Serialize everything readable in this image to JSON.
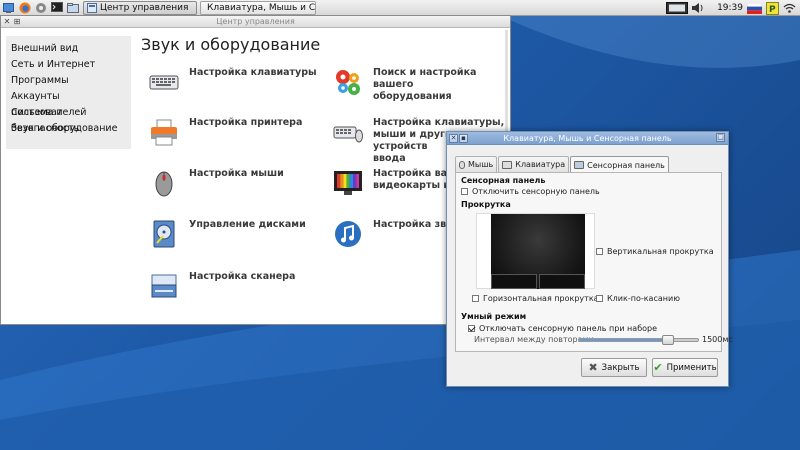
{
  "taskbar": {
    "launchers": [
      "desktop-icon",
      "firefox-icon",
      "settings-icon",
      "terminal-icon",
      "file-manager-icon"
    ],
    "tasks": [
      {
        "label": "Центр управления",
        "icon": "control-center-icon"
      },
      {
        "label": "Клавиатура, Мышь и Сенс...",
        "icon": "keyboard-mouse-icon"
      }
    ],
    "clock": "19:39",
    "tray": [
      "display-icon",
      "sound-icon",
      "language-flag-icon",
      "updates-icon",
      "wifi-icon"
    ]
  },
  "main_window": {
    "title": "Центр управления",
    "sidebar": [
      "Внешний вид",
      "Сеть и Интернет",
      "Программы",
      "Аккаунты пользователей",
      "Система и безопасность",
      "Звук и оборудование"
    ],
    "page_title": "Звук и оборудование",
    "items": [
      {
        "label": "Настройка клавиатуры",
        "icon": "keyboard-icon"
      },
      {
        "label": "Поиск и настройка вашего\nоборудования",
        "icon": "hardware-gears-icon"
      },
      {
        "label": "Настройка принтера",
        "icon": "printer-icon"
      },
      {
        "label": "Настройка клавиатуры,\nмыши и других устройств\nввода",
        "icon": "input-devices-icon"
      },
      {
        "label": "Настройка мыши",
        "icon": "mouse-icon"
      },
      {
        "label": "Настройка вашей\nвидеокарты и мон",
        "icon": "monitor-icon"
      },
      {
        "label": "Управление дисками",
        "icon": "disk-icon"
      },
      {
        "label": "Настройка звука",
        "icon": "music-note-icon"
      },
      {
        "label": "Настройка сканера",
        "icon": "scanner-icon"
      }
    ]
  },
  "dialog": {
    "title": "Клавиатура, Мышь и Сенсорная панель",
    "tabs": [
      "Мышь",
      "Клавиатура",
      "Сенсорная панель"
    ],
    "active_tab": "Сенсорная панель",
    "touchpad_section": "Сенсорная панель",
    "disable_touchpad": {
      "label": "Отключить сенсорную панель",
      "checked": false
    },
    "scroll_section": "Прокрутка",
    "vertical_scroll": {
      "label": "Вертикальная прокрутка",
      "checked": false
    },
    "horizontal_scroll": {
      "label": "Горизонтальная прокрутка",
      "checked": false
    },
    "tap_to_click": {
      "label": "Клик-по-касанию",
      "checked": false
    },
    "smart_section": "Умный режим",
    "disable_while_typing": {
      "label": "Отключать сенсорную панель при наборе",
      "checked": true
    },
    "repeat_interval_label": "Интервал между повторами:",
    "repeat_interval_fraction": 0.75,
    "repeat_interval_value": "1500мс",
    "close_button": "Закрыть",
    "apply_button": "Применить"
  }
}
